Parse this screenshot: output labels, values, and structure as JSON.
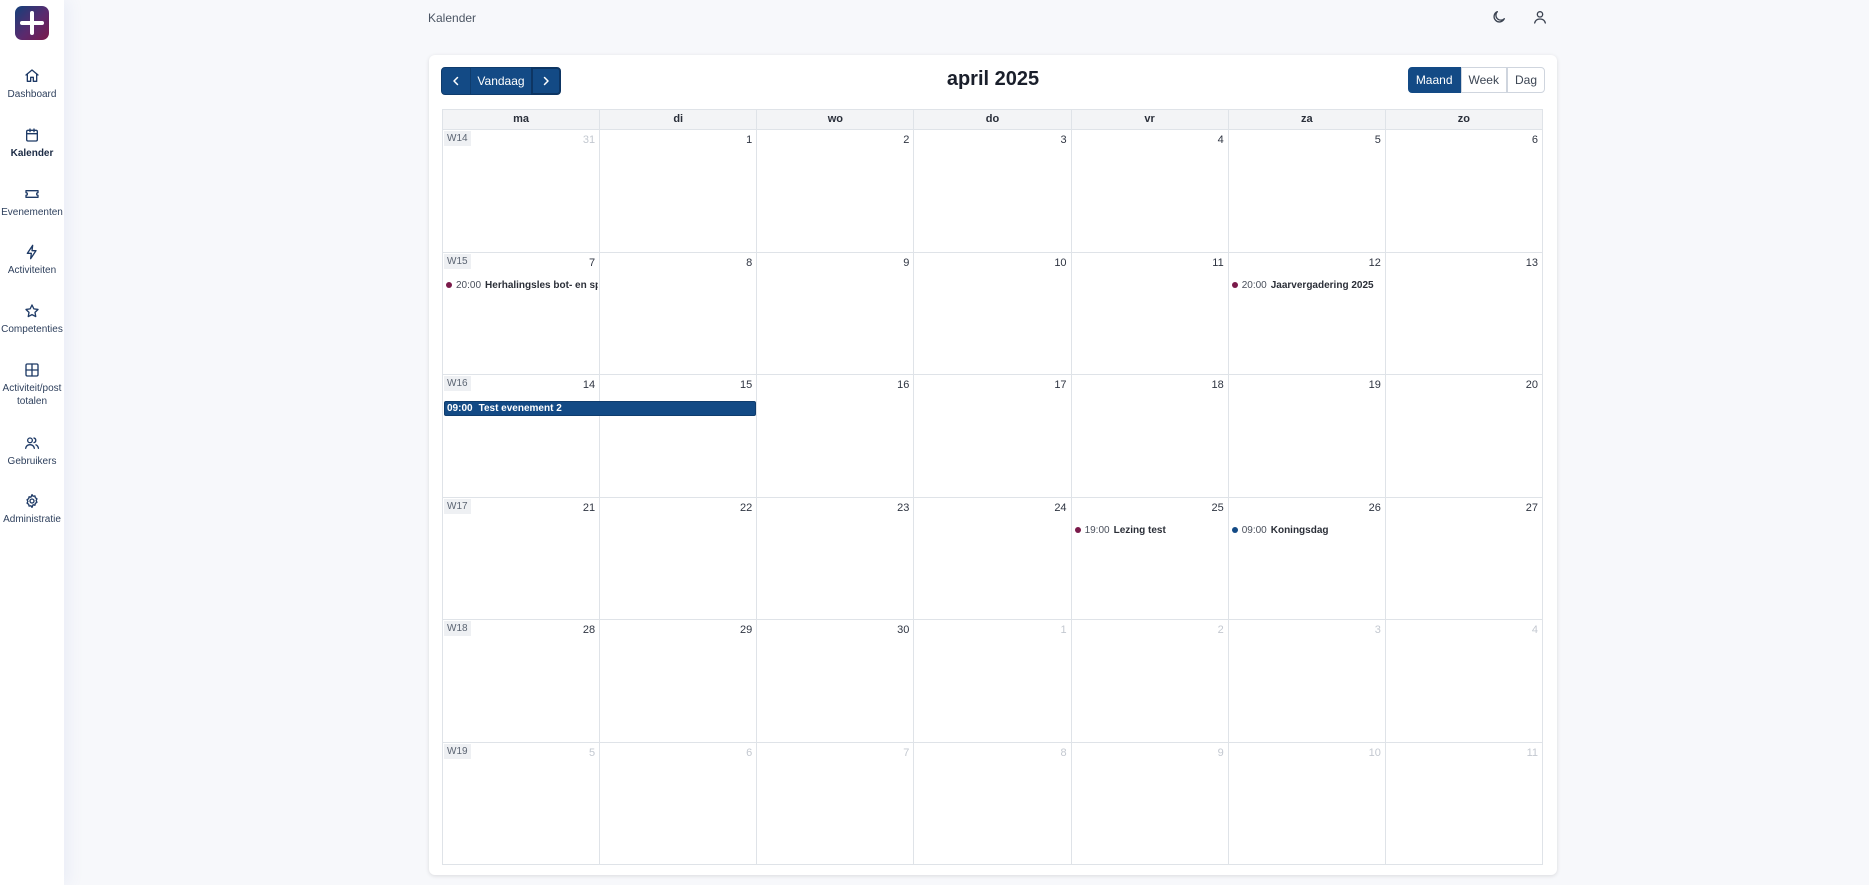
{
  "sidebar": {
    "items": [
      {
        "label": "Dashboard",
        "icon": "home-icon"
      },
      {
        "label": "Kalender",
        "icon": "calendar-icon",
        "active": true
      },
      {
        "label": "Evenementen",
        "icon": "ticket-icon"
      },
      {
        "label": "Activiteiten",
        "icon": "lightning-icon"
      },
      {
        "label": "Competenties",
        "icon": "star-icon"
      },
      {
        "label": "Activiteit/post totalen",
        "icon": "grid-icon"
      },
      {
        "label": "Gebruikers",
        "icon": "users-icon"
      },
      {
        "label": "Administratie",
        "icon": "gear-icon"
      }
    ]
  },
  "header": {
    "title": "Kalender",
    "icons": [
      "moon-icon",
      "user-icon"
    ]
  },
  "calendar": {
    "title": "april 2025",
    "today_label": "Vandaag",
    "views": [
      "Maand",
      "Week",
      "Dag"
    ],
    "active_view": "Maand",
    "weekdays": [
      "ma",
      "di",
      "wo",
      "do",
      "vr",
      "za",
      "zo"
    ],
    "weeks": [
      {
        "label": "W14",
        "days": [
          {
            "n": "31",
            "other": true
          },
          {
            "n": "1"
          },
          {
            "n": "2"
          },
          {
            "n": "3"
          },
          {
            "n": "4"
          },
          {
            "n": "5"
          },
          {
            "n": "6"
          }
        ]
      },
      {
        "label": "W15",
        "days": [
          {
            "n": "7"
          },
          {
            "n": "8"
          },
          {
            "n": "9"
          },
          {
            "n": "10"
          },
          {
            "n": "11"
          },
          {
            "n": "12"
          },
          {
            "n": "13"
          }
        ]
      },
      {
        "label": "W16",
        "days": [
          {
            "n": "14"
          },
          {
            "n": "15"
          },
          {
            "n": "16"
          },
          {
            "n": "17"
          },
          {
            "n": "18"
          },
          {
            "n": "19"
          },
          {
            "n": "20"
          }
        ]
      },
      {
        "label": "W17",
        "days": [
          {
            "n": "21"
          },
          {
            "n": "22"
          },
          {
            "n": "23"
          },
          {
            "n": "24"
          },
          {
            "n": "25"
          },
          {
            "n": "26"
          },
          {
            "n": "27"
          }
        ]
      },
      {
        "label": "W18",
        "days": [
          {
            "n": "28"
          },
          {
            "n": "29"
          },
          {
            "n": "30"
          },
          {
            "n": "1",
            "other": true
          },
          {
            "n": "2",
            "other": true
          },
          {
            "n": "3",
            "other": true
          },
          {
            "n": "4",
            "other": true
          }
        ]
      },
      {
        "label": "W19",
        "days": [
          {
            "n": "5",
            "other": true
          },
          {
            "n": "6",
            "other": true
          },
          {
            "n": "7",
            "other": true
          },
          {
            "n": "8",
            "other": true
          },
          {
            "n": "9",
            "other": true
          },
          {
            "n": "10",
            "other": true
          },
          {
            "n": "11",
            "other": true
          }
        ]
      }
    ],
    "events": [
      {
        "week": 1,
        "day": 0,
        "time": "20:00",
        "title": "Herhalingsles bot- en spi",
        "color": "#7a1a4a"
      },
      {
        "week": 1,
        "day": 5,
        "time": "20:00",
        "title": "Jaarvergadering 2025",
        "color": "#7a1a4a"
      },
      {
        "week": 3,
        "day": 4,
        "time": "19:00",
        "title": "Lezing test",
        "color": "#7a1a4a"
      },
      {
        "week": 3,
        "day": 5,
        "time": "09:00",
        "title": "Koningsdag",
        "color": "#134a85"
      }
    ],
    "multi_day_event": {
      "week": 2,
      "start_day": 0,
      "span_days": 2,
      "time": "09:00",
      "title": "Test evenement 2",
      "color": "#134a85"
    }
  },
  "colors": {
    "accent": "#134a85",
    "event_dot_purple": "#7a1a4a"
  }
}
